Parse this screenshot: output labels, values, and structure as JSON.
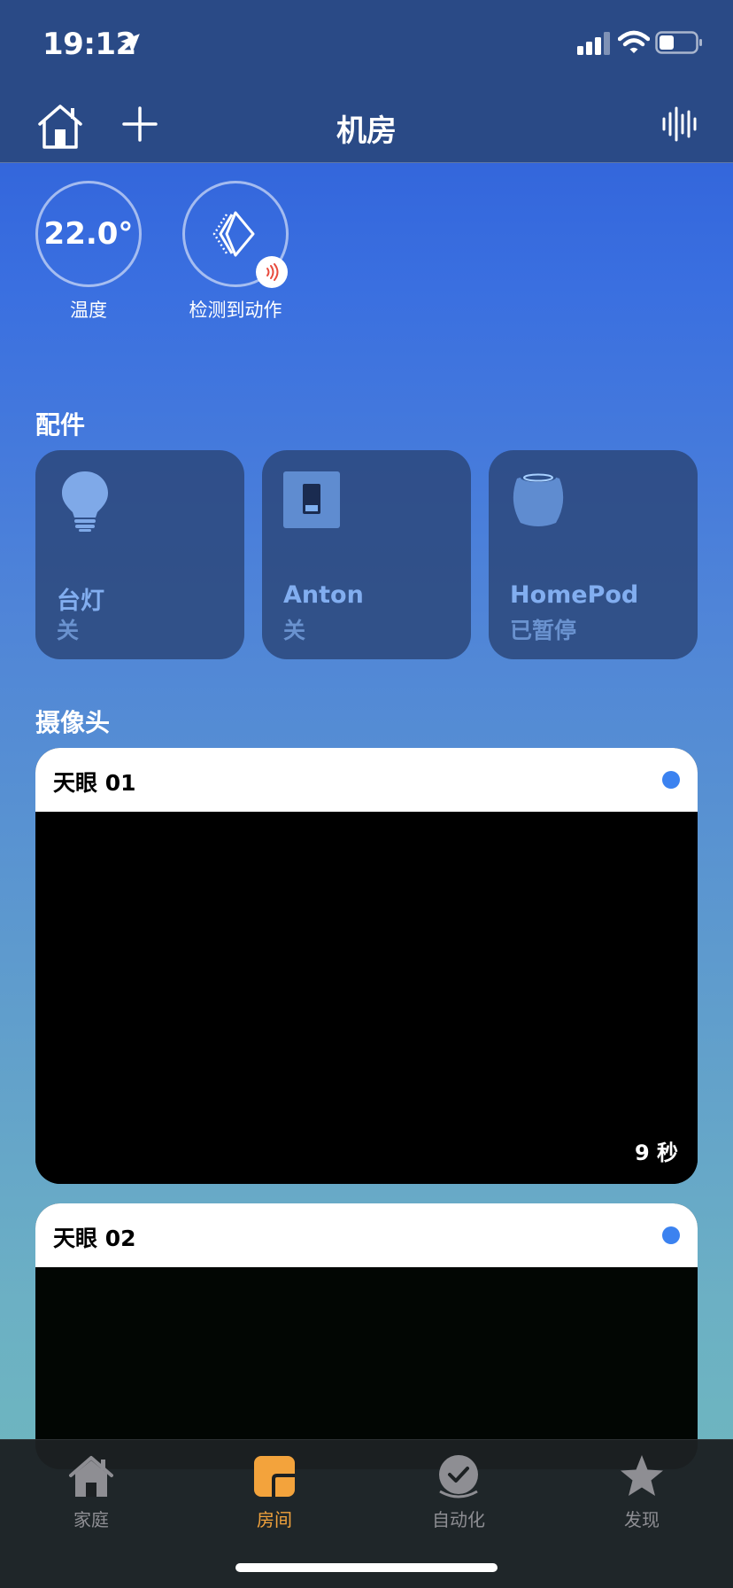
{
  "status_bar": {
    "time": "19:12"
  },
  "nav": {
    "title": "机房"
  },
  "status_items": [
    {
      "value": "22.0°",
      "label": "温度"
    },
    {
      "label": "检测到动作"
    }
  ],
  "sections": {
    "accessories": "配件",
    "cameras": "摄像头"
  },
  "accessories": [
    {
      "name": "台灯",
      "state": "关",
      "icon": "lightbulb-icon"
    },
    {
      "name": "Anton",
      "state": "关",
      "icon": "switch-icon"
    },
    {
      "name": "HomePod",
      "state": "已暂停",
      "icon": "homepod-icon"
    }
  ],
  "cameras": [
    {
      "name": "天眼 01",
      "time": "9 秒"
    },
    {
      "name": "天眼 02"
    }
  ],
  "tabs": [
    {
      "label": "家庭",
      "icon": "home-icon"
    },
    {
      "label": "房间",
      "icon": "rooms-icon",
      "active": true
    },
    {
      "label": "自动化",
      "icon": "automation-icon"
    },
    {
      "label": "发现",
      "icon": "star-icon"
    }
  ],
  "colors": {
    "accent_tab": "#f3a33c",
    "camera_dot": "#3b82f0",
    "tile_text": "#82aef0"
  }
}
